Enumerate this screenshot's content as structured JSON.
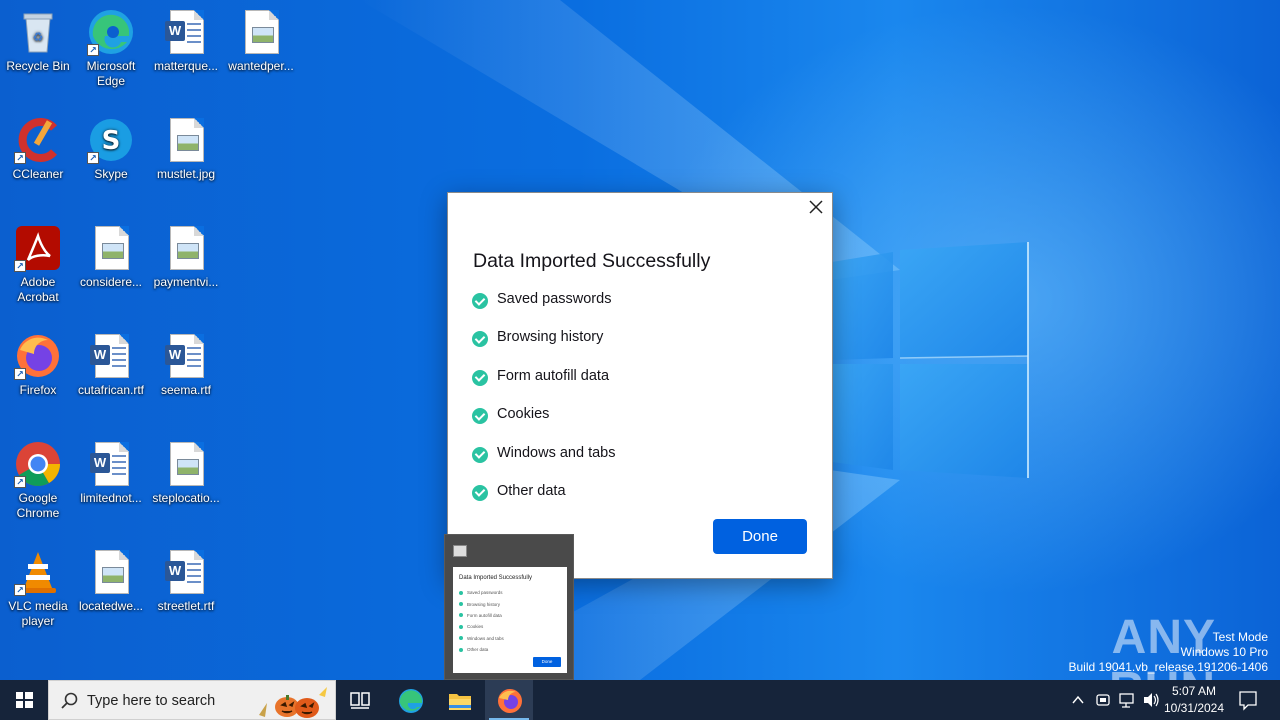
{
  "desktop": {
    "icons": [
      {
        "label": "Recycle Bin",
        "icon": "recycle-bin-icon"
      },
      {
        "label": "Microsoft Edge",
        "icon": "edge-icon"
      },
      {
        "label": "matterque...",
        "icon": "word-doc-icon"
      },
      {
        "label": "wantedper...",
        "icon": "image-file-icon"
      },
      {
        "label": "CCleaner",
        "icon": "ccleaner-icon"
      },
      {
        "label": "Skype",
        "icon": "skype-icon"
      },
      {
        "label": "mustlet.jpg",
        "icon": "image-file-icon"
      },
      {
        "label": "Adobe Acrobat",
        "icon": "acrobat-icon"
      },
      {
        "label": "considere...",
        "icon": "image-file-icon"
      },
      {
        "label": "paymentvi...",
        "icon": "image-file-icon"
      },
      {
        "label": "Firefox",
        "icon": "firefox-icon"
      },
      {
        "label": "cutafrican.rtf",
        "icon": "word-doc-icon"
      },
      {
        "label": "seema.rtf",
        "icon": "word-doc-icon"
      },
      {
        "label": "Google Chrome",
        "icon": "chrome-icon"
      },
      {
        "label": "limitednot...",
        "icon": "word-doc-icon"
      },
      {
        "label": "steplocatio...",
        "icon": "image-file-icon"
      },
      {
        "label": "VLC media player",
        "icon": "vlc-icon"
      },
      {
        "label": "locatedwe...",
        "icon": "image-file-icon"
      },
      {
        "label": "streetlet.rtf",
        "icon": "word-doc-icon"
      }
    ]
  },
  "dialog": {
    "title": "Data Imported Successfully",
    "items": [
      "Saved passwords",
      "Browsing history",
      "Form autofill data",
      "Cookies",
      "Windows and tabs",
      "Other data"
    ],
    "done_label": "Done",
    "check_color": "#2ac3a2",
    "button_color": "#0061e0"
  },
  "preview": {
    "title": "Data Imported Successfully",
    "items": [
      "Saved passwords",
      "Browsing history",
      "Form autofill data",
      "Cookies",
      "Windows and tabs",
      "Other data"
    ],
    "done_label": "Done"
  },
  "watermark": {
    "logo": "ANY RUN",
    "line1": "Test Mode",
    "line2": "Windows 10 Pro",
    "line3": "Build 19041.vb_release.191206-1406"
  },
  "taskbar": {
    "search_placeholder": "Type here to search",
    "pinned": [
      "task-view-icon",
      "edge-icon",
      "file-explorer-icon",
      "firefox-icon"
    ],
    "active": "firefox-icon",
    "time": "5:07 AM",
    "date": "10/31/2024"
  }
}
